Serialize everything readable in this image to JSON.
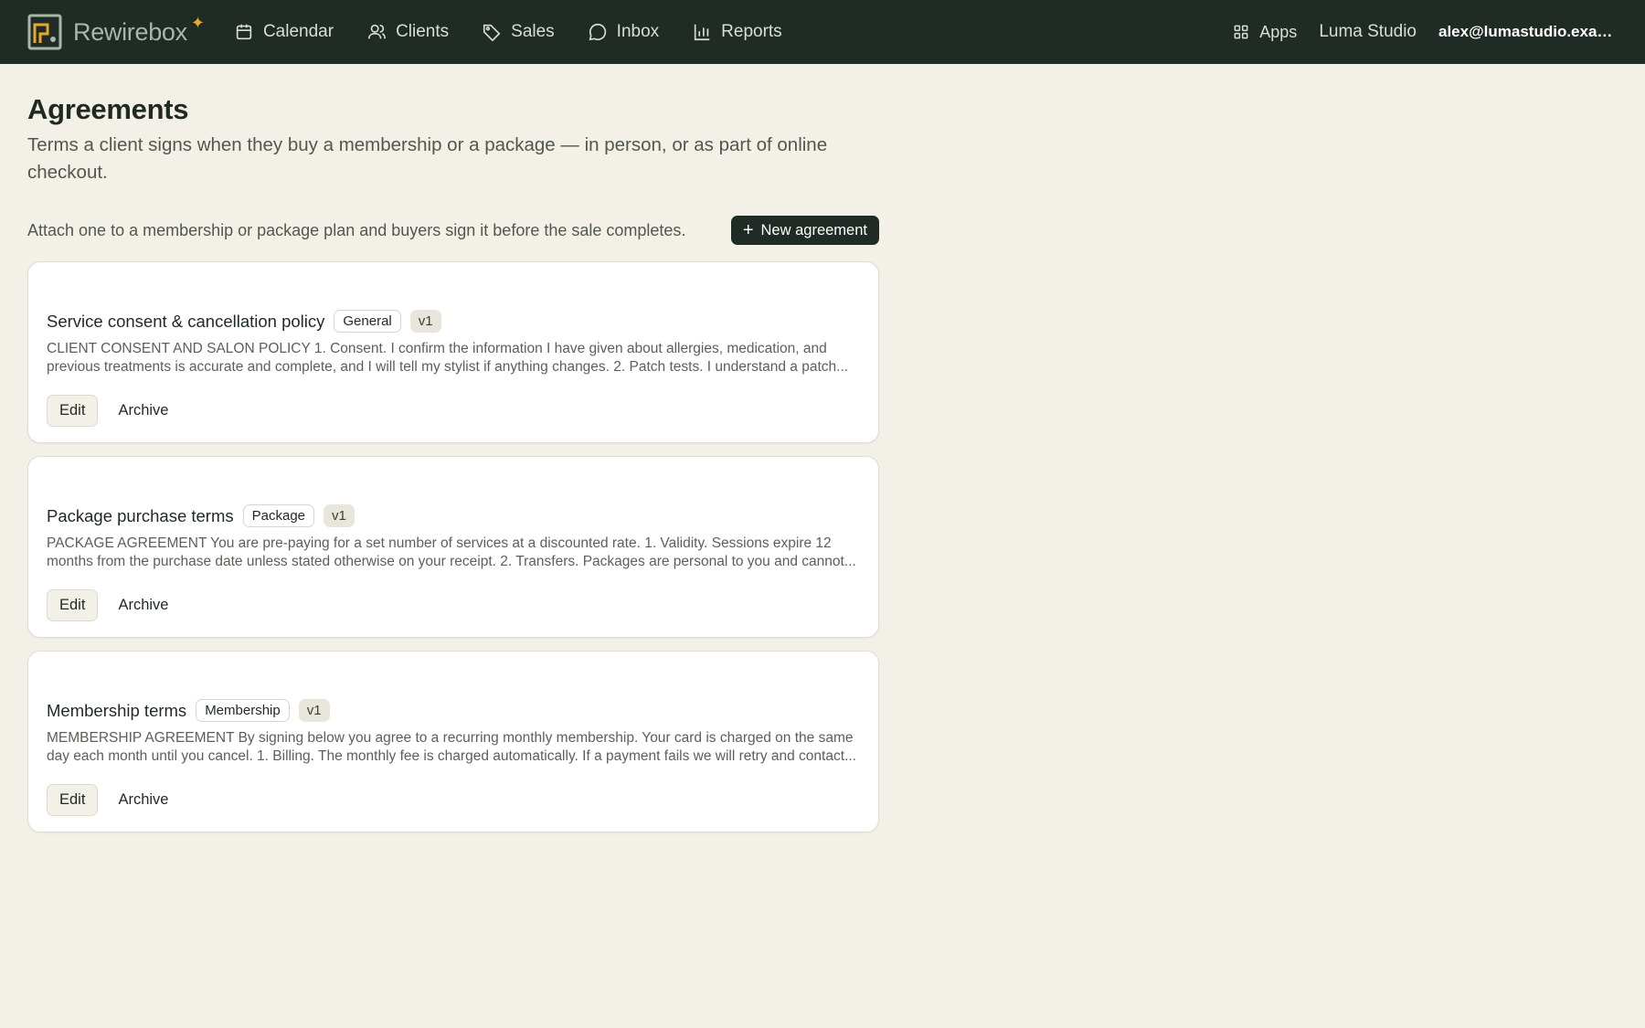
{
  "app": {
    "brand": "Rewirebox",
    "nav": [
      {
        "label": "Calendar",
        "icon": "calendar-icon"
      },
      {
        "label": "Clients",
        "icon": "users-icon"
      },
      {
        "label": "Sales",
        "icon": "tag-icon"
      },
      {
        "label": "Inbox",
        "icon": "chat-icon"
      },
      {
        "label": "Reports",
        "icon": "bar-chart-icon"
      }
    ],
    "apps_label": "Apps",
    "studio": "Luma Studio",
    "email": "alex@lumastudio.example.com"
  },
  "page": {
    "title": "Agreements",
    "subtitle": "Terms a client signs when they buy a membership or a package — in person, or as part of online checkout.",
    "helper": "Attach one to a membership or package plan and buyers sign it before the sale completes.",
    "new_button": "New agreement"
  },
  "agreements": [
    {
      "title": "Service consent & cancellation policy",
      "tag": "General",
      "version": "v1",
      "body": "CLIENT CONSENT AND SALON POLICY 1. Consent. I confirm the information I have given about allergies, medication, and previous treatments is accurate and complete, and I will tell my stylist if anything changes. 2. Patch tests. I understand a patch...",
      "edit": "Edit",
      "archive": "Archive"
    },
    {
      "title": "Package purchase terms",
      "tag": "Package",
      "version": "v1",
      "body": "PACKAGE AGREEMENT You are pre-paying for a set number of services at a discounted rate. 1. Validity. Sessions expire 12 months from the purchase date unless stated otherwise on your receipt. 2. Transfers. Packages are personal to you and cannot...",
      "edit": "Edit",
      "archive": "Archive"
    },
    {
      "title": "Membership terms",
      "tag": "Membership",
      "version": "v1",
      "body": "MEMBERSHIP AGREEMENT By signing below you agree to a recurring monthly membership. Your card is charged on the same day each month until you cancel. 1. Billing. The monthly fee is charged automatically. If a payment fails we will retry and contact...",
      "edit": "Edit",
      "archive": "Archive"
    }
  ],
  "colors": {
    "topbar": "#1f2b24",
    "background": "#f3f0e8",
    "accent": "#e6a92b"
  }
}
